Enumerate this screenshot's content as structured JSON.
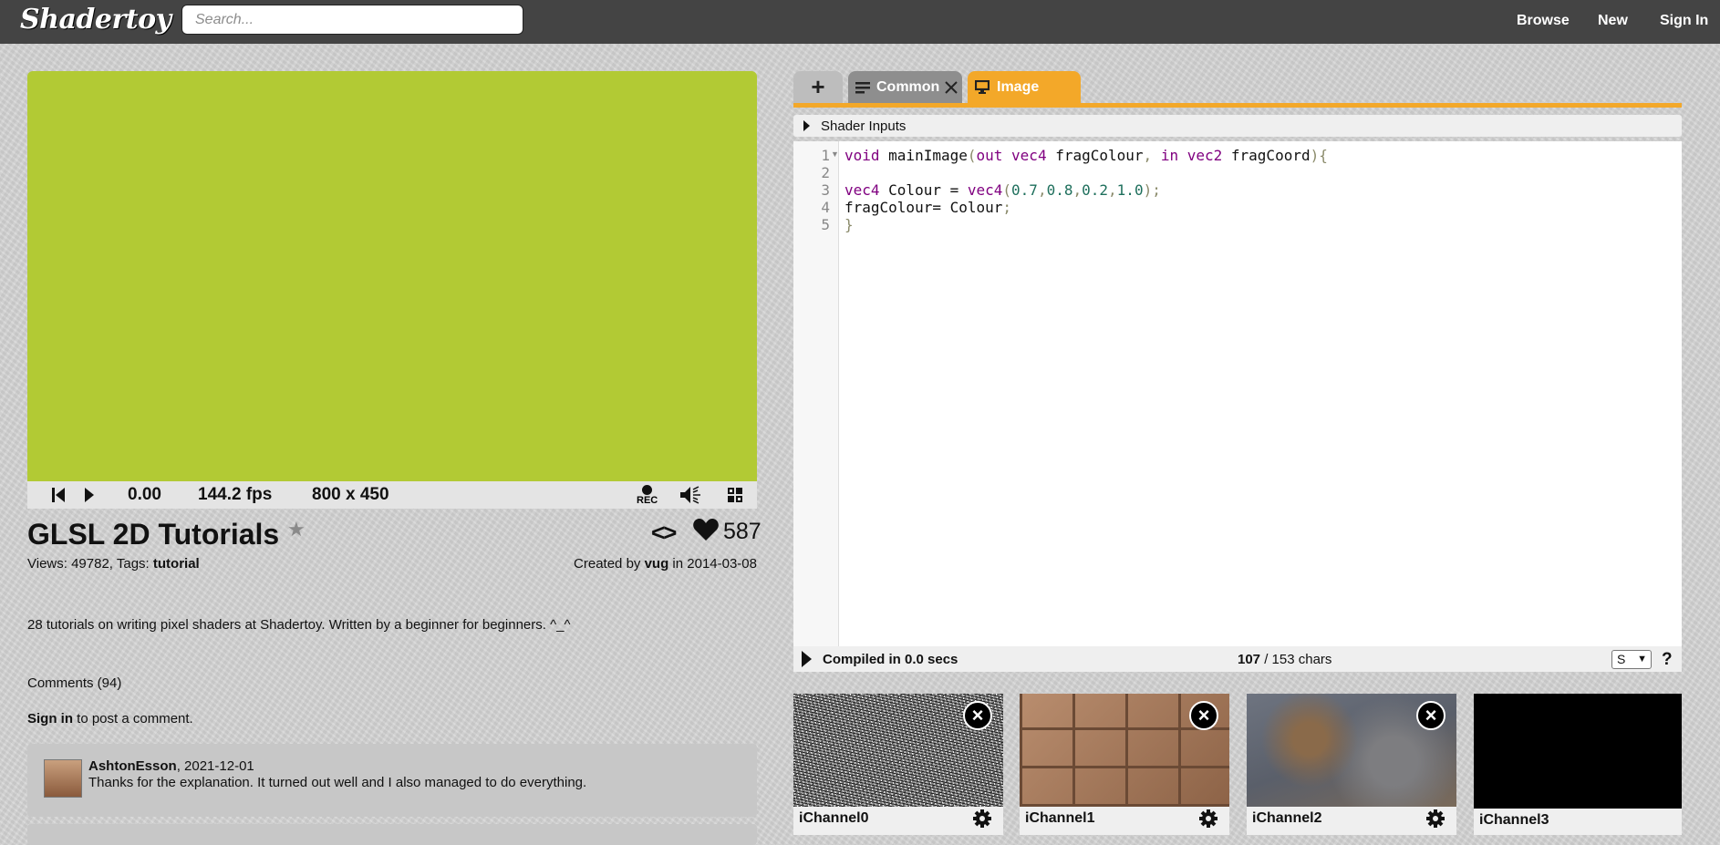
{
  "header": {
    "logo": "Shadertoy",
    "search_placeholder": "Search...",
    "nav": [
      "Browse",
      "New",
      "Sign In"
    ]
  },
  "player": {
    "canvas_color": "#b2ca34",
    "time": "0.00",
    "fps": "144.2 fps",
    "resolution": "800 x 450",
    "rec_label": "REC"
  },
  "shader": {
    "title": "GLSL 2D Tutorials",
    "likes": "587",
    "views_label": "Views: 49782, Tags: ",
    "tag": "tutorial",
    "created_prefix": "Created by ",
    "author": "vug",
    "created_suffix": " in 2014-03-08",
    "description": "28 tutorials on writing pixel shaders at Shadertoy. Written by a beginner for beginners.  ^_^"
  },
  "comments": {
    "heading": "Comments (94)",
    "signin_link": "Sign in",
    "signin_rest": " to post a comment.",
    "items": [
      {
        "author": "AshtonEsson",
        "date": ", 2021-12-01",
        "text": "Thanks for the explanation. It turned out well and I also managed to do everything."
      }
    ]
  },
  "editor": {
    "tabs": {
      "add": "+",
      "common": "Common",
      "image": "Image"
    },
    "accent_color": "#f3a829",
    "shader_inputs_label": "Shader Inputs",
    "line_numbers": [
      "1",
      "2",
      "3",
      "4",
      "5"
    ],
    "code": {
      "l1": {
        "a": "void",
        "b": " mainImage",
        "c": "(",
        "d": "out",
        "e": " vec4",
        "f": " fragColour",
        "g": ",",
        "h": " in",
        "i": " vec2",
        "j": " fragCoord",
        "k": "){"
      },
      "l3": {
        "a": "vec4",
        "b": " Colour = ",
        "c": "vec4",
        "d": "(",
        "e": "0.7",
        "f": ",",
        "g": "0.8",
        "h": ",",
        "i": "0.2",
        "j": ",",
        "k": "1.0",
        "l": ");"
      },
      "l4": {
        "a": "fragColour= Colour",
        "b": ";"
      },
      "l5": {
        "a": "}"
      }
    },
    "compiled": "Compiled in 0.0 secs",
    "chars_used": "107",
    "chars_total": " / 153 chars",
    "font_size_option": "S",
    "help": "?"
  },
  "channels": [
    {
      "label": "iChannel0"
    },
    {
      "label": "iChannel1"
    },
    {
      "label": "iChannel2"
    },
    {
      "label": "iChannel3"
    }
  ]
}
